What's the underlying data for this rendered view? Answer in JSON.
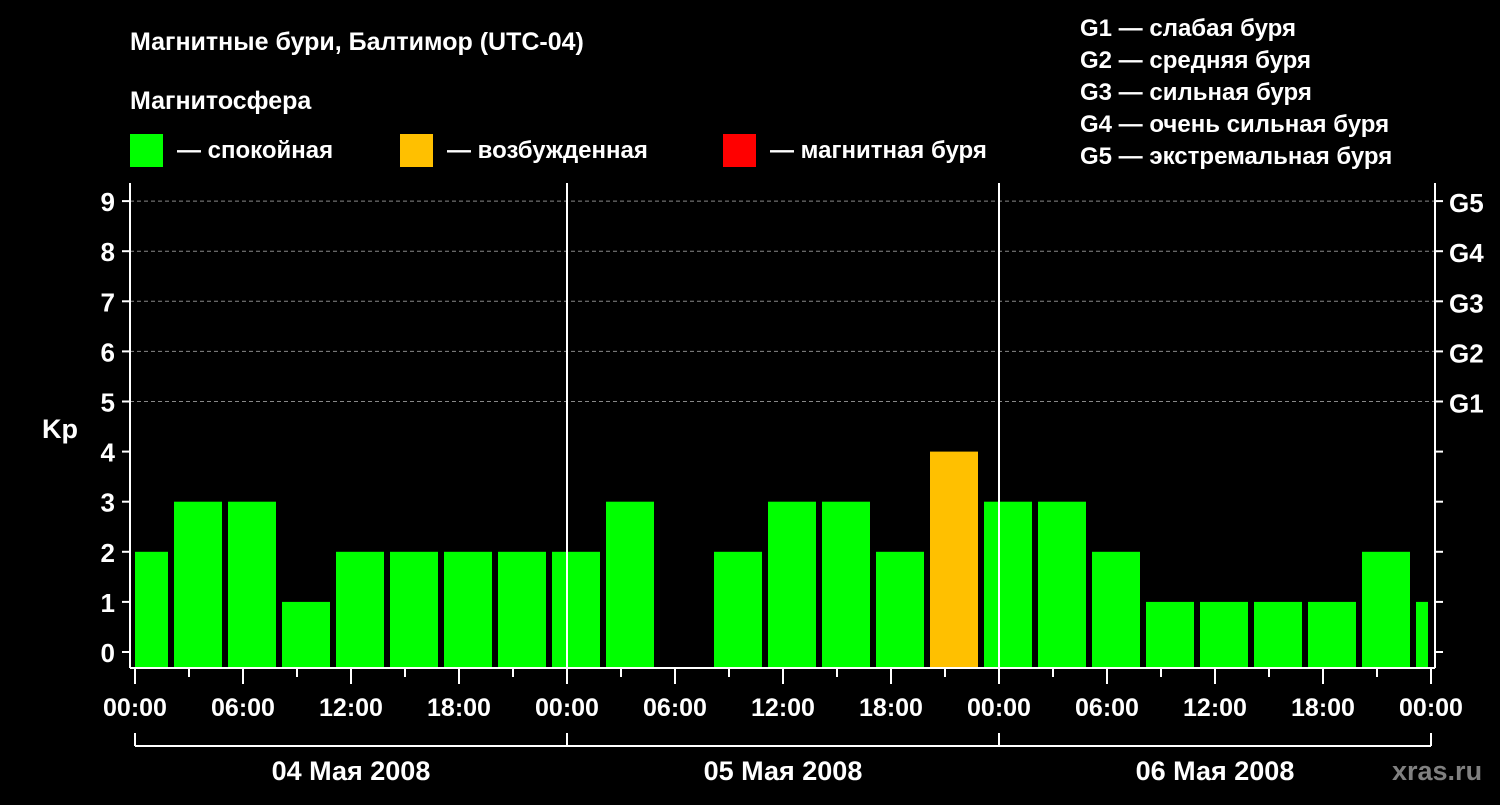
{
  "chart_data": {
    "type": "bar",
    "title": "Магнитные бури, Балтимор (UTC-04)",
    "legend_title": "Магнитосфера",
    "legend": [
      {
        "label": "— спокойная",
        "color": "#00ff00"
      },
      {
        "label": "— возбужденная",
        "color": "#ffc000"
      },
      {
        "label": "— магнитная буря",
        "color": "#ff0000"
      }
    ],
    "g_legend": [
      "G1 — слабая буря",
      "G2 — средняя буря",
      "G3 — сильная буря",
      "G4 — очень сильная буря",
      "G5 — экстремальная буря"
    ],
    "ylabel": "Kp",
    "ylim": [
      0,
      9
    ],
    "yticks": [
      0,
      1,
      2,
      3,
      4,
      5,
      6,
      7,
      8,
      9
    ],
    "right_ticks": [
      {
        "kp": 5,
        "label": "G1"
      },
      {
        "kp": 6,
        "label": "G2"
      },
      {
        "kp": 7,
        "label": "G3"
      },
      {
        "kp": 8,
        "label": "G4"
      },
      {
        "kp": 9,
        "label": "G5"
      }
    ],
    "xlim_hours": [
      0,
      72
    ],
    "xtick_labels": [
      "00:00",
      "06:00",
      "12:00",
      "18:00",
      "00:00",
      "06:00",
      "12:00",
      "18:00",
      "00:00",
      "06:00",
      "12:00",
      "18:00",
      "00:00"
    ],
    "days": [
      "04 Мая 2008",
      "05 Мая 2008",
      "06 Мая 2008"
    ],
    "interval_hours": 3,
    "bars": [
      {
        "start": -1,
        "kp": 2,
        "level": "quiet"
      },
      {
        "start": 2,
        "kp": 3,
        "level": "quiet"
      },
      {
        "start": 5,
        "kp": 3,
        "level": "quiet"
      },
      {
        "start": 8,
        "kp": 1,
        "level": "quiet"
      },
      {
        "start": 11,
        "kp": 2,
        "level": "quiet"
      },
      {
        "start": 14,
        "kp": 2,
        "level": "quiet"
      },
      {
        "start": 17,
        "kp": 2,
        "level": "quiet"
      },
      {
        "start": 20,
        "kp": 2,
        "level": "quiet"
      },
      {
        "start": 23,
        "kp": 2,
        "level": "quiet"
      },
      {
        "start": 26,
        "kp": 3,
        "level": "quiet"
      },
      {
        "start": 32,
        "kp": 2,
        "level": "quiet"
      },
      {
        "start": 35,
        "kp": 3,
        "level": "quiet"
      },
      {
        "start": 38,
        "kp": 3,
        "level": "quiet"
      },
      {
        "start": 41,
        "kp": 2,
        "level": "quiet"
      },
      {
        "start": 44,
        "kp": 4,
        "level": "active"
      },
      {
        "start": 47,
        "kp": 3,
        "level": "quiet"
      },
      {
        "start": 50,
        "kp": 3,
        "level": "quiet"
      },
      {
        "start": 53,
        "kp": 2,
        "level": "quiet"
      },
      {
        "start": 56,
        "kp": 1,
        "level": "quiet"
      },
      {
        "start": 59,
        "kp": 1,
        "level": "quiet"
      },
      {
        "start": 62,
        "kp": 1,
        "level": "quiet"
      },
      {
        "start": 65,
        "kp": 1,
        "level": "quiet"
      },
      {
        "start": 68,
        "kp": 2,
        "level": "quiet"
      },
      {
        "start": 71,
        "kp": 1,
        "level": "quiet"
      }
    ],
    "colors": {
      "quiet": "#00ff00",
      "active": "#ffc000",
      "storm": "#ff0000"
    },
    "grid": "dashed at Kp 5-9"
  },
  "watermark": "xras.ru"
}
